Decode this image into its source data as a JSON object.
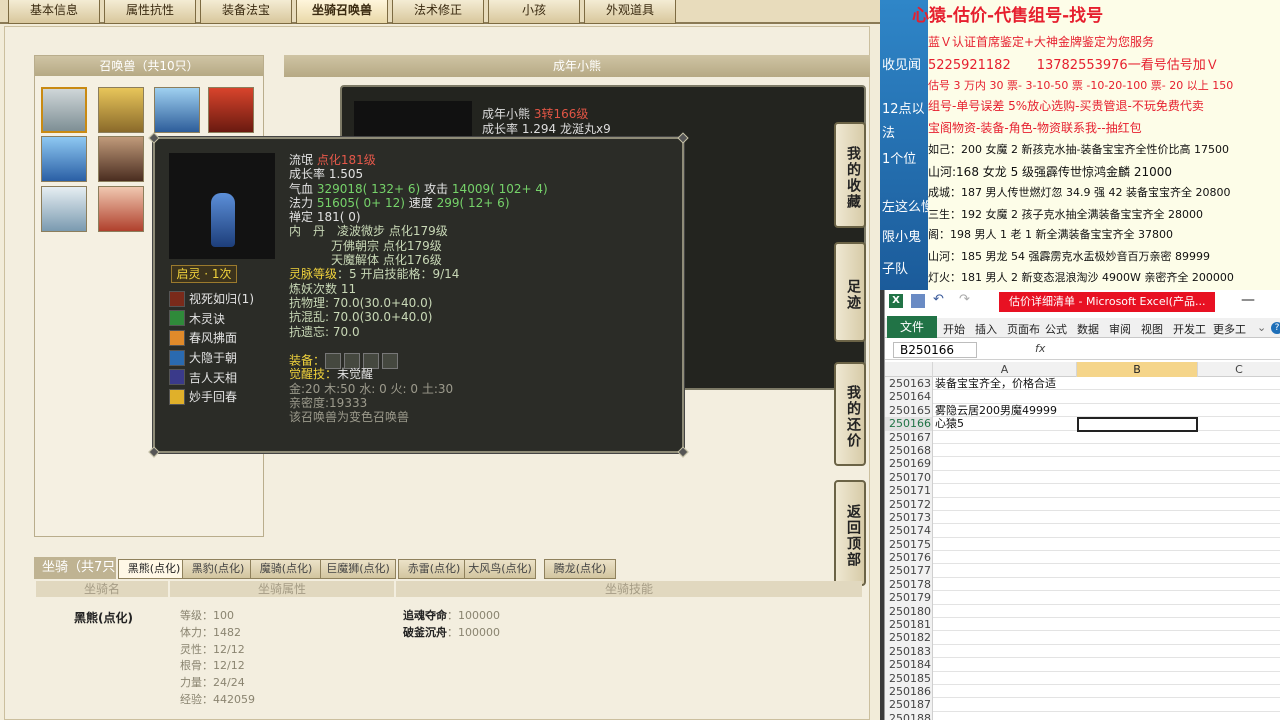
{
  "tabs": [
    "基本信息",
    "属性抗性",
    "装备法宝",
    "坐骑召唤兽",
    "法术修正",
    "小孩",
    "外观道具"
  ],
  "summon_list": {
    "title": "召唤兽（共10只）"
  },
  "detail": {
    "header": "成年小熊",
    "name": "成年小熊",
    "level": "3转166级",
    "growth": "成长率 1.294 龙涎丸x9"
  },
  "side_buttons": [
    "我的收藏",
    "足迹",
    "我的还价",
    "返回顶部"
  ],
  "popup": {
    "name": "流氓",
    "level": "点化181级",
    "growth": "成长率 1.505",
    "hp_label": "气血",
    "hp_val": "329018( 132+ 6)",
    "atk_label": "攻击",
    "atk_val": "14009( 102+ 4)",
    "mp_label": "法力",
    "mp_val": "51605( 0+ 12)",
    "spd_label": "速度",
    "spd_val": "299( 12+ 6)",
    "focus": "禅定 181( 0)",
    "neidan_label": "内　丹",
    "neidan1": "凌波微步 点化179级",
    "neidan2": "万佛朝宗 点化179级",
    "neidan3": "天魔解体 点化176级",
    "rank_label": "灵脉等级",
    "rank_val": "：5 开启技能格：9/14",
    "refine": "炼妖次数 11",
    "res1": "抗物理: 70.0(30.0+40.0)",
    "res2": "抗混乱: 70.0(30.0+40.0)",
    "res3": "抗遗忘: 70.0",
    "equip_label": "装备：",
    "awaken_label": "觉醒技：",
    "awaken_val": "未觉醒",
    "elements": "金:20 木:50 水: 0 火: 0 土:30",
    "intimacy": "亲密度:19333",
    "note": "该召唤兽为变色召唤兽",
    "enlight": "启灵 · 1次",
    "skills": [
      "视死如归(1)",
      "木灵诀",
      "春风拂面",
      "大隐于朝",
      "吉人天相",
      "妙手回春"
    ]
  },
  "ride": {
    "label": "坐骑（共7只",
    "tabs": [
      "黑熊(点化)",
      "黑豹(点化)",
      "魔骑(点化)",
      "巨魔狮(点化)",
      "赤雷(点化)",
      "大风鸟(点化)",
      "腾龙(点化)"
    ],
    "col1": "坐骑名",
    "col2": "坐骑属性",
    "col3": "坐骑技能",
    "name": "黑熊(点化)",
    "attrs": [
      "等级：100",
      "体力：1482",
      "灵性：12/12",
      "根骨：12/12",
      "力量：24/24",
      "经验：442059"
    ],
    "skill1_name": "追魂夺命",
    "skill1_val": "：100000",
    "skill2_name": "破釜沉舟",
    "skill2_val": "：100000"
  },
  "chat": {
    "title": "心猿-估价-代售组号-找号",
    "side": [
      "收见闻",
      "12点以",
      "法",
      "1个位",
      "左这么慢",
      "限小鬼",
      "子队"
    ],
    "lines": [
      "蓝Ｖ认证首席鉴定+大神金牌鉴定为您服务",
      "5225921182　　13782553976一看号估号加Ｖ",
      "估号 3 万内 30 票- 3-10-50 票 -10-20-100 票- 20 以上 150",
      "组号-单号误差 5%放心选购-买贵管退-不玩免费代卖",
      "宝阁物资-装备-角色-物资联系我--抽红包",
      "如己：200 女魔 2 新孩克水抽-装备宝宝齐全性价比高 17500",
      "山河:168 女龙 5 级强霹传世惊鸿金麟 21000",
      "成城：187 男人传世燃灯忽 34.9 强 42 装备宝宝齐全 20800",
      "三生：192 女魔 2 孩子克水抽全满装备宝宝齐全 28000",
      "阁：198 男人 1 老 1 新全满装备宝宝齐全 37800",
      "山河：185 男龙 54 强霹雳克水盂极妙音百万亲密 89999",
      "灯火：181 男人 2 新变态混浪淘沙 4900W 亲密齐全 200000"
    ]
  },
  "excel": {
    "window_title": "估价详细清单 - Microsoft Excel(产品...",
    "file": "文件",
    "menus": [
      "开始",
      "插入",
      "页面布",
      "公式",
      "数据",
      "审阅",
      "视图",
      "开发工",
      "更多工"
    ],
    "namebox": "B250166",
    "fx": "fx",
    "cols": [
      "A",
      "B",
      "C"
    ],
    "rows": [
      {
        "n": "250163",
        "a": "装备宝宝齐全，价格合适"
      },
      {
        "n": "250164",
        "a": ""
      },
      {
        "n": "250165",
        "a": "雾隐云居200男魔49999"
      },
      {
        "n": "250166",
        "a": "心猿5"
      },
      {
        "n": "250167",
        "a": ""
      },
      {
        "n": "250168",
        "a": ""
      },
      {
        "n": "250169",
        "a": ""
      },
      {
        "n": "250170",
        "a": ""
      },
      {
        "n": "250171",
        "a": ""
      },
      {
        "n": "250172",
        "a": ""
      },
      {
        "n": "250173",
        "a": ""
      },
      {
        "n": "250174",
        "a": ""
      },
      {
        "n": "250175",
        "a": ""
      },
      {
        "n": "250176",
        "a": ""
      },
      {
        "n": "250177",
        "a": ""
      },
      {
        "n": "250178",
        "a": ""
      },
      {
        "n": "250179",
        "a": ""
      },
      {
        "n": "250180",
        "a": ""
      },
      {
        "n": "250181",
        "a": ""
      },
      {
        "n": "250182",
        "a": ""
      },
      {
        "n": "250183",
        "a": ""
      },
      {
        "n": "250184",
        "a": ""
      },
      {
        "n": "250185",
        "a": ""
      },
      {
        "n": "250186",
        "a": ""
      },
      {
        "n": "250187",
        "a": ""
      },
      {
        "n": "250188",
        "a": ""
      }
    ]
  }
}
